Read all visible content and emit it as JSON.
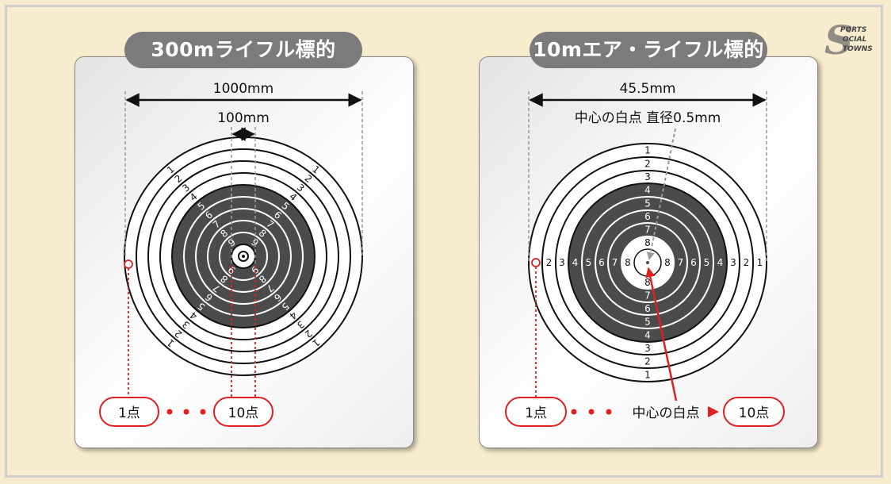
{
  "panels": {
    "left": {
      "title": "300mライフル標的",
      "width_label": "1000mm",
      "inner_label": "100mm",
      "ring_numbers": [
        "1",
        "2",
        "3",
        "4",
        "5",
        "6",
        "7",
        "8",
        "9"
      ],
      "score_low": "1点",
      "score_high": "10点"
    },
    "right": {
      "title": "10mエア・ライフル標的",
      "width_label": "45.5mm",
      "center_note": "中心の白点 直径0.5mm",
      "ring_numbers": [
        "1",
        "2",
        "3",
        "4",
        "5",
        "6",
        "7",
        "8"
      ],
      "score_low": "1点",
      "center_label": "中心の白点",
      "score_high": "10点"
    }
  },
  "logo": {
    "text": "SPORTS SOCIAL TOWNS"
  },
  "colors": {
    "background": "#f8ecce",
    "pill": "#7b7b7b",
    "ring_line": "#111111",
    "black_zone": "#4b4b4b",
    "red": "#e02020"
  }
}
